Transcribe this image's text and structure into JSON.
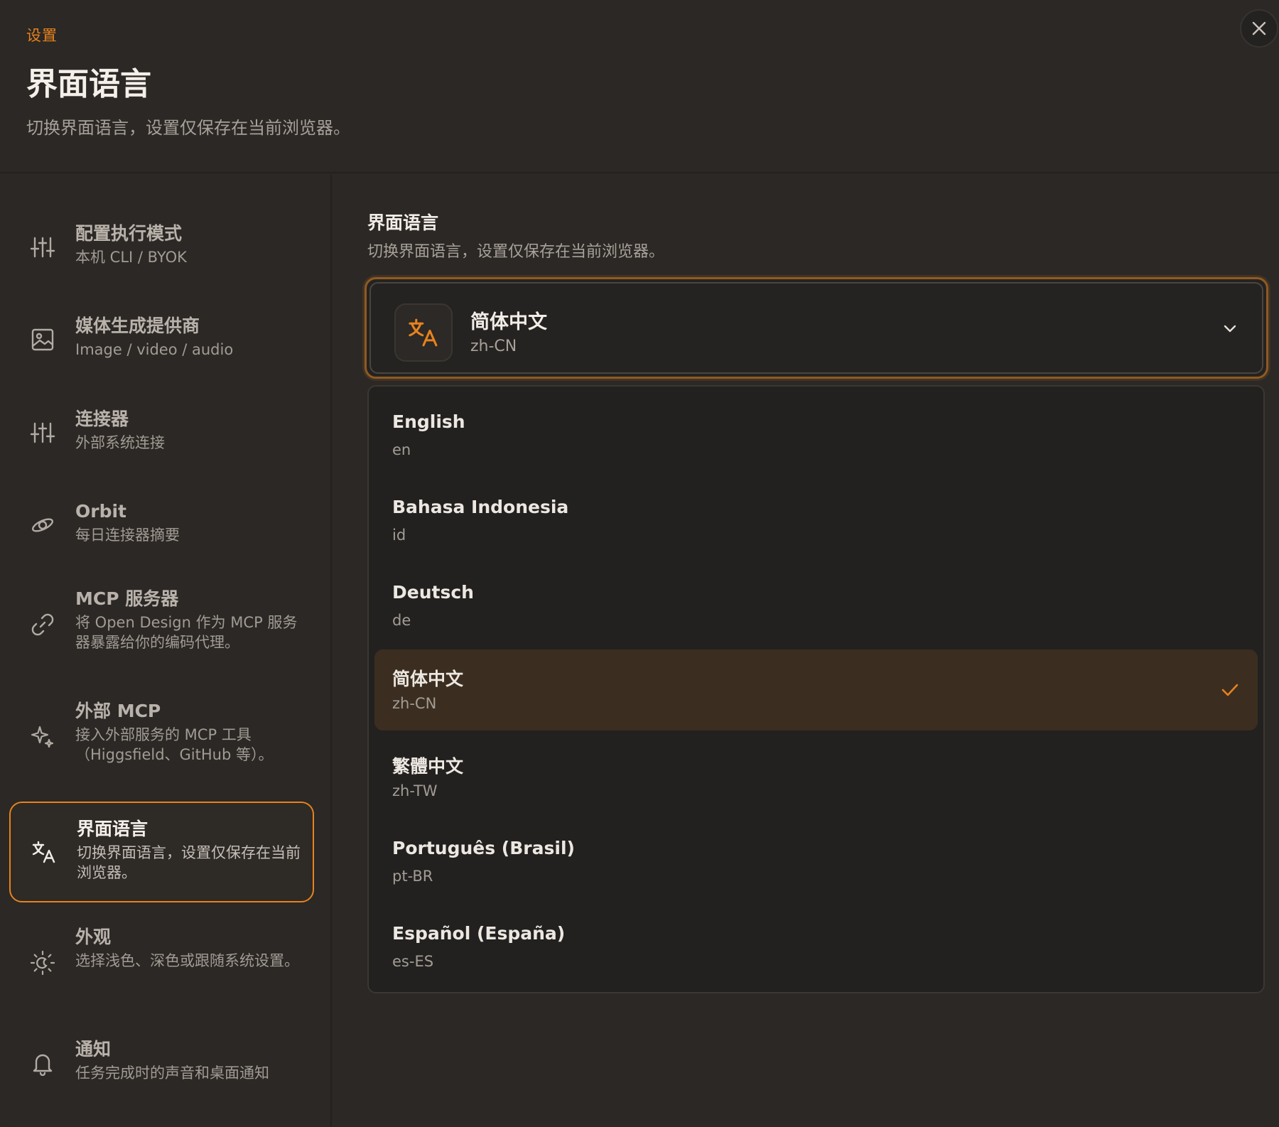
{
  "header": {
    "eyebrow": "设置",
    "title": "界面语言",
    "subtitle": "切换界面语言，设置仅保存在当前浏览器。",
    "close_icon": "close-icon"
  },
  "sidebar": {
    "items": [
      {
        "id": "execution-mode",
        "title": "配置执行模式",
        "desc": "本机 CLI / BYOK",
        "icon": "sliders-icon",
        "active": false
      },
      {
        "id": "media-providers",
        "title": "媒体生成提供商",
        "desc": "Image / video / audio",
        "icon": "image-icon",
        "active": false
      },
      {
        "id": "connectors",
        "title": "连接器",
        "desc": "外部系统连接",
        "icon": "sliders-icon",
        "active": false
      },
      {
        "id": "orbit",
        "title": "Orbit",
        "desc": "每日连接器摘要",
        "icon": "orbit-icon",
        "active": false
      },
      {
        "id": "mcp-server",
        "title": "MCP 服务器",
        "desc": "将 Open Design 作为 MCP 服务器暴露给你的编码代理。",
        "icon": "link-icon",
        "active": false
      },
      {
        "id": "external-mcp",
        "title": "外部 MCP",
        "desc": "接入外部服务的 MCP 工具（Higgsfield、GitHub 等）。",
        "icon": "sparkle-icon",
        "active": false
      },
      {
        "id": "language",
        "title": "界面语言",
        "desc": "切换界面语言，设置仅保存在当前浏览器。",
        "icon": "translate-icon",
        "active": true
      },
      {
        "id": "appearance",
        "title": "外观",
        "desc": "选择浅色、深色或跟随系统设置。",
        "icon": "sun-moon-icon",
        "active": false
      },
      {
        "id": "notifications",
        "title": "通知",
        "desc": "任务完成时的声音和桌面通知",
        "icon": "bell-icon",
        "active": false
      }
    ]
  },
  "main": {
    "section_title": "界面语言",
    "section_desc": "切换界面语言，设置仅保存在当前浏览器。",
    "select": {
      "label": "简体中文",
      "code": "zh-CN",
      "icon": "translate-icon",
      "chevron": "chevron-down-icon"
    },
    "options": [
      {
        "label": "English",
        "code": "en",
        "selected": false
      },
      {
        "label": "Bahasa Indonesia",
        "code": "id",
        "selected": false
      },
      {
        "label": "Deutsch",
        "code": "de",
        "selected": false
      },
      {
        "label": "简体中文",
        "code": "zh-CN",
        "selected": true
      },
      {
        "label": "繁體中文",
        "code": "zh-TW",
        "selected": false
      },
      {
        "label": "Português (Brasil)",
        "code": "pt-BR",
        "selected": false
      },
      {
        "label": "Español (España)",
        "code": "es-ES",
        "selected": false
      }
    ]
  },
  "colors": {
    "accent": "#e8821d",
    "background": "#2b2825",
    "dropdown_bg": "#222120",
    "selected_bg": "#3b2e20"
  }
}
